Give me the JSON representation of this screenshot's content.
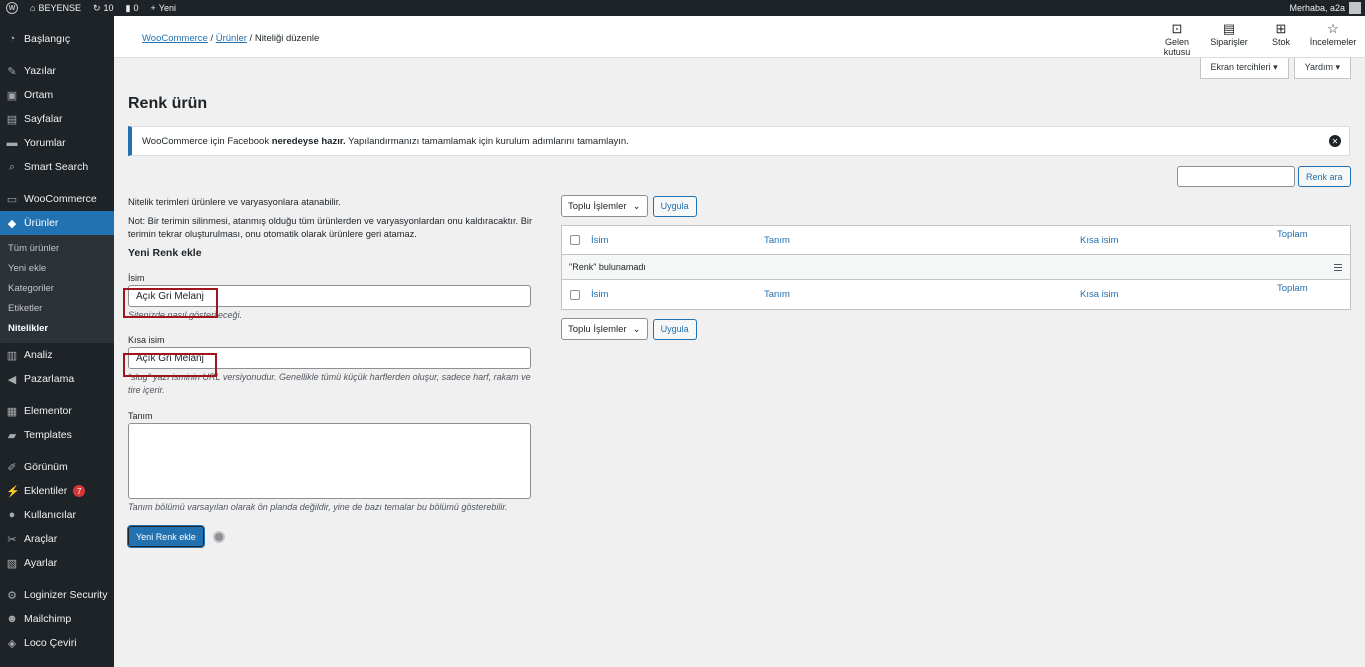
{
  "adminbar": {
    "site_name": "BEYENSE",
    "updates_count": "10",
    "comments_count": "0",
    "new_label": "Yeni",
    "greeting": "Merhaba, a2a"
  },
  "sidebar": {
    "items": [
      {
        "label": "Başlangıç",
        "icon": "dashboard-icon"
      },
      {
        "label": "Yazılar",
        "icon": "pin-icon"
      },
      {
        "label": "Ortam",
        "icon": "media-icon"
      },
      {
        "label": "Sayfalar",
        "icon": "pages-icon"
      },
      {
        "label": "Yorumlar",
        "icon": "comments-icon"
      },
      {
        "label": "Smart Search",
        "icon": "search-icon"
      },
      {
        "label": "WooCommerce",
        "icon": "woo-icon"
      },
      {
        "label": "Ürünler",
        "icon": "products-icon"
      },
      {
        "label": "Analiz",
        "icon": "chart-icon"
      },
      {
        "label": "Pazarlama",
        "icon": "megaphone-icon"
      },
      {
        "label": "Elementor",
        "icon": "elementor-icon"
      },
      {
        "label": "Templates",
        "icon": "folder-icon"
      },
      {
        "label": "Görünüm",
        "icon": "brush-icon"
      },
      {
        "label": "Eklentiler",
        "icon": "plugin-icon",
        "badge": "7"
      },
      {
        "label": "Kullanıcılar",
        "icon": "users-icon"
      },
      {
        "label": "Araçlar",
        "icon": "wrench-icon"
      },
      {
        "label": "Ayarlar",
        "icon": "settings-icon"
      },
      {
        "label": "Loginizer Security",
        "icon": "gear-icon"
      },
      {
        "label": "Mailchimp",
        "icon": "mailchimp-icon"
      },
      {
        "label": "Loco Çeviri",
        "icon": "translate-icon"
      }
    ],
    "submenu": [
      "Tüm ürünler",
      "Yeni ekle",
      "Kategoriler",
      "Etiketler",
      "Nitelikler"
    ]
  },
  "header": {
    "breadcrumb": [
      "WooCommerce",
      "Ürünler",
      "Niteliği düzenle"
    ],
    "tools": [
      {
        "label": "Gelen kutusu",
        "icon": "inbox-icon"
      },
      {
        "label": "Siparişler",
        "icon": "orders-icon"
      },
      {
        "label": "Stok",
        "icon": "stock-icon"
      },
      {
        "label": "İncelemeler",
        "icon": "star-icon"
      }
    ],
    "screen_options": "Ekran tercihleri",
    "help": "Yardım"
  },
  "page": {
    "title": "Renk ürün",
    "notice_pre": "WooCommerce için Facebook ",
    "notice_bold": "neredeyse hazır.",
    "notice_post": " Yapılandırmanızı tamamlamak için kurulum adımlarını tamamlayın.",
    "search_button": "Renk ara"
  },
  "form": {
    "intro": "Nitelik terimleri ürünlere ve varyasyonlara atanabilir.",
    "note": "Not: Bir terimin silinmesi, atanmış olduğu tüm ürünlerden ve varyasyonlardan onu kaldıracaktır. Bir terimin tekrar oluşturulması, onu otomatik olarak ürünlere geri atamaz.",
    "heading": "Yeni Renk ekle",
    "name_label": "İsim",
    "name_value": "Açık Gri Melanj",
    "name_desc": "Sitenizde nasıl gösterileceği.",
    "slug_label": "Kısa isim",
    "slug_value": "Açık Gri Melanj",
    "slug_desc": "“slug” yazı isminin URL versiyonudur. Genellikle tümü küçük harflerden oluşur, sadece harf, rakam ve tire içerir.",
    "desc_label": "Tanım",
    "desc_desc": "Tanım bölümü varsayılan olarak ön planda değildir, yine de bazı temalar bu bölümü gösterebilir.",
    "submit": "Yeni Renk ekle"
  },
  "table": {
    "bulk_select": "Toplu İşlemler",
    "apply": "Uygula",
    "columns": [
      "İsim",
      "Tanım",
      "Kısa isim",
      "Toplam"
    ],
    "empty": "\"Renk\" bulunamadı"
  }
}
